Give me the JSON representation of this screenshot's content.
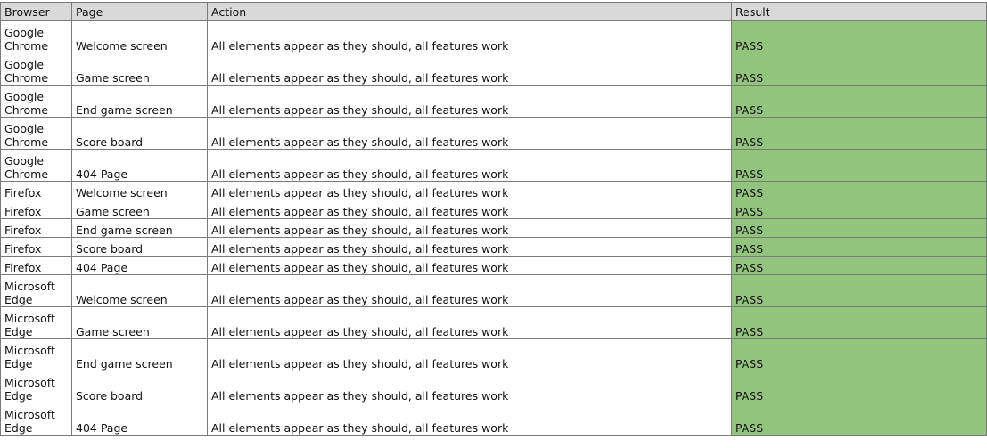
{
  "headers": {
    "browser": "Browser",
    "page": "Page",
    "action": "Action",
    "result": "Result"
  },
  "colors": {
    "header_background": "#d9d9d9",
    "pass_background": "#93c47d",
    "grid_line": "#7a7a7a"
  },
  "rows": [
    {
      "browser": "Google Chrome",
      "page": "Welcome screen",
      "action": "All elements appear as they should, all features work",
      "result": "PASS"
    },
    {
      "browser": "Google Chrome",
      "page": "Game screen",
      "action": "All elements appear as they should, all features work",
      "result": "PASS"
    },
    {
      "browser": "Google Chrome",
      "page": "End game screen",
      "action": "All elements appear as they should, all features work",
      "result": "PASS"
    },
    {
      "browser": "Google Chrome",
      "page": "Score board",
      "action": "All elements appear as they should, all features work",
      "result": "PASS"
    },
    {
      "browser": "Google Chrome",
      "page": "404 Page",
      "action": "All elements appear as they should, all features work",
      "result": "PASS"
    },
    {
      "browser": "Firefox",
      "page": "Welcome screen",
      "action": "All elements appear as they should, all features work",
      "result": "PASS"
    },
    {
      "browser": "Firefox",
      "page": "Game screen",
      "action": "All elements appear as they should, all features work",
      "result": "PASS"
    },
    {
      "browser": "Firefox",
      "page": "End game screen",
      "action": "All elements appear as they should, all features work",
      "result": "PASS"
    },
    {
      "browser": "Firefox",
      "page": "Score board",
      "action": "All elements appear as they should, all features work",
      "result": "PASS"
    },
    {
      "browser": "Firefox",
      "page": "404 Page",
      "action": "All elements appear as they should, all features work",
      "result": "PASS"
    },
    {
      "browser": "Microsoft Edge",
      "page": "Welcome screen",
      "action": "All elements appear as they should, all features work",
      "result": "PASS"
    },
    {
      "browser": "Microsoft Edge",
      "page": "Game screen",
      "action": "All elements appear as they should, all features work",
      "result": "PASS"
    },
    {
      "browser": "Microsoft Edge",
      "page": "End game screen",
      "action": "All elements appear as they should, all features work",
      "result": "PASS"
    },
    {
      "browser": "Microsoft Edge",
      "page": "Score board",
      "action": "All elements appear as they should, all features work",
      "result": "PASS"
    },
    {
      "browser": "Microsoft Edge",
      "page": "404 Page",
      "action": "All elements appear as they should, all features work",
      "result": "PASS"
    }
  ]
}
